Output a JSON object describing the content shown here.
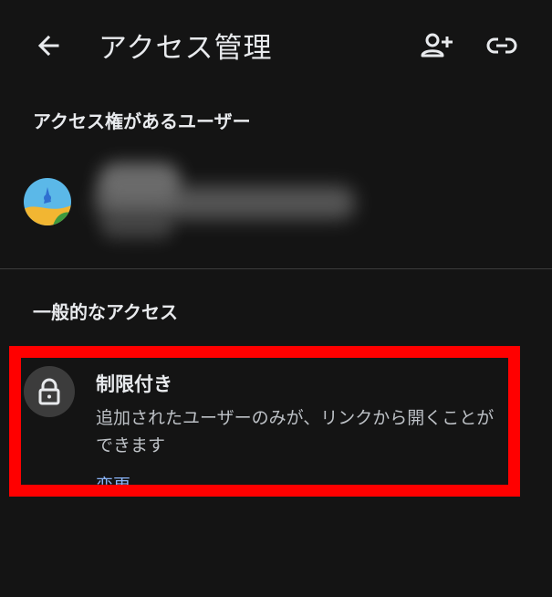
{
  "header": {
    "title": "アクセス管理",
    "icons": {
      "back": "arrow-back-icon",
      "add_user": "person-add-icon",
      "link": "link-icon"
    }
  },
  "users_section": {
    "title": "アクセス権があるユーザー",
    "users": [
      {
        "avatar_icon": "avatar"
      }
    ]
  },
  "general_access": {
    "title": "一般的なアクセス",
    "option": {
      "icon": "lock-icon",
      "label": "制限付き",
      "description": "追加されたユーザーのみが、リンクから開くことができます",
      "change_label": "変更"
    }
  },
  "colors": {
    "background": "#141414",
    "text": "#e8eaed",
    "secondary_text": "#bdc1c6",
    "link": "#8ab4f8",
    "highlight": "#ff0000"
  }
}
